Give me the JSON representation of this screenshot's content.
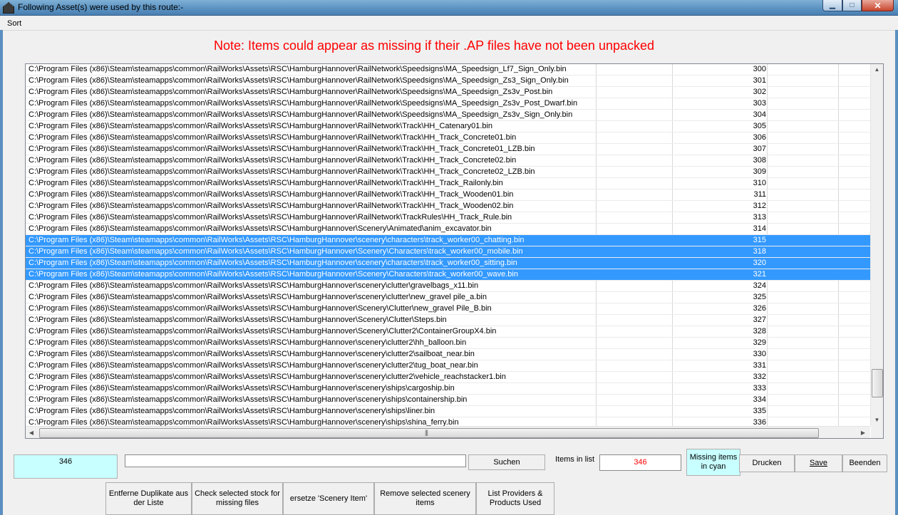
{
  "window": {
    "title": "Following Asset(s) were used by this route:-",
    "minimize_icon": "minimize-icon",
    "maximize_icon": "maximize-icon",
    "close_icon": "close-icon"
  },
  "menu": {
    "sort": "Sort"
  },
  "note": "Note: Items could appear as missing if their .AP files have not been unpacked",
  "list": {
    "rows": [
      {
        "path": "C:\\Program Files (x86)\\Steam\\steamapps\\common\\RailWorks\\Assets\\RSC\\HamburgHannover\\RailNetwork\\Speedsigns\\MA_Speedsign_Lf7_Sign_Only.bin",
        "num": "300",
        "selected": false
      },
      {
        "path": "C:\\Program Files (x86)\\Steam\\steamapps\\common\\RailWorks\\Assets\\RSC\\HamburgHannover\\RailNetwork\\Speedsigns\\MA_Speedsign_Zs3_Sign_Only.bin",
        "num": "301",
        "selected": false
      },
      {
        "path": "C:\\Program Files (x86)\\Steam\\steamapps\\common\\RailWorks\\Assets\\RSC\\HamburgHannover\\RailNetwork\\Speedsigns\\MA_Speedsign_Zs3v_Post.bin",
        "num": "302",
        "selected": false
      },
      {
        "path": "C:\\Program Files (x86)\\Steam\\steamapps\\common\\RailWorks\\Assets\\RSC\\HamburgHannover\\RailNetwork\\Speedsigns\\MA_Speedsign_Zs3v_Post_Dwarf.bin",
        "num": "303",
        "selected": false
      },
      {
        "path": "C:\\Program Files (x86)\\Steam\\steamapps\\common\\RailWorks\\Assets\\RSC\\HamburgHannover\\RailNetwork\\Speedsigns\\MA_Speedsign_Zs3v_Sign_Only.bin",
        "num": "304",
        "selected": false
      },
      {
        "path": "C:\\Program Files (x86)\\Steam\\steamapps\\common\\RailWorks\\Assets\\RSC\\HamburgHannover\\RailNetwork\\Track\\HH_Catenary01.bin",
        "num": "305",
        "selected": false
      },
      {
        "path": "C:\\Program Files (x86)\\Steam\\steamapps\\common\\RailWorks\\Assets\\RSC\\HamburgHannover\\RailNetwork\\Track\\HH_Track_Concrete01.bin",
        "num": "306",
        "selected": false
      },
      {
        "path": "C:\\Program Files (x86)\\Steam\\steamapps\\common\\RailWorks\\Assets\\RSC\\HamburgHannover\\RailNetwork\\Track\\HH_Track_Concrete01_LZB.bin",
        "num": "307",
        "selected": false
      },
      {
        "path": "C:\\Program Files (x86)\\Steam\\steamapps\\common\\RailWorks\\Assets\\RSC\\HamburgHannover\\RailNetwork\\Track\\HH_Track_Concrete02.bin",
        "num": "308",
        "selected": false
      },
      {
        "path": "C:\\Program Files (x86)\\Steam\\steamapps\\common\\RailWorks\\Assets\\RSC\\HamburgHannover\\RailNetwork\\Track\\HH_Track_Concrete02_LZB.bin",
        "num": "309",
        "selected": false
      },
      {
        "path": "C:\\Program Files (x86)\\Steam\\steamapps\\common\\RailWorks\\Assets\\RSC\\HamburgHannover\\RailNetwork\\Track\\HH_Track_Railonly.bin",
        "num": "310",
        "selected": false
      },
      {
        "path": "C:\\Program Files (x86)\\Steam\\steamapps\\common\\RailWorks\\Assets\\RSC\\HamburgHannover\\RailNetwork\\Track\\HH_Track_Wooden01.bin",
        "num": "311",
        "selected": false
      },
      {
        "path": "C:\\Program Files (x86)\\Steam\\steamapps\\common\\RailWorks\\Assets\\RSC\\HamburgHannover\\RailNetwork\\Track\\HH_Track_Wooden02.bin",
        "num": "312",
        "selected": false
      },
      {
        "path": "C:\\Program Files (x86)\\Steam\\steamapps\\common\\RailWorks\\Assets\\RSC\\HamburgHannover\\RailNetwork\\TrackRules\\HH_Track_Rule.bin",
        "num": "313",
        "selected": false
      },
      {
        "path": "C:\\Program Files (x86)\\Steam\\steamapps\\common\\RailWorks\\Assets\\RSC\\HamburgHannover\\Scenery\\Animated\\anim_excavator.bin",
        "num": "314",
        "selected": false
      },
      {
        "path": "C:\\Program Files (x86)\\Steam\\steamapps\\common\\RailWorks\\Assets\\RSC\\HamburgHannover\\scenery\\characters\\track_worker00_chatting.bin",
        "num": "315",
        "selected": true
      },
      {
        "path": "C:\\Program Files (x86)\\Steam\\steamapps\\common\\RailWorks\\Assets\\RSC\\HamburgHannover\\Scenery\\Characters\\track_worker00_mobile.bin",
        "num": "318",
        "selected": true
      },
      {
        "path": "C:\\Program Files (x86)\\Steam\\steamapps\\common\\RailWorks\\Assets\\RSC\\HamburgHannover\\scenery\\characters\\track_worker00_sitting.bin",
        "num": "320",
        "selected": true
      },
      {
        "path": "C:\\Program Files (x86)\\Steam\\steamapps\\common\\RailWorks\\Assets\\RSC\\HamburgHannover\\Scenery\\Characters\\track_worker00_wave.bin",
        "num": "321",
        "selected": true
      },
      {
        "path": "C:\\Program Files (x86)\\Steam\\steamapps\\common\\RailWorks\\Assets\\RSC\\HamburgHannover\\scenery\\clutter\\gravelbags_x11.bin",
        "num": "324",
        "selected": false
      },
      {
        "path": "C:\\Program Files (x86)\\Steam\\steamapps\\common\\RailWorks\\Assets\\RSC\\HamburgHannover\\scenery\\clutter\\new_gravel pile_a.bin",
        "num": "325",
        "selected": false
      },
      {
        "path": "C:\\Program Files (x86)\\Steam\\steamapps\\common\\RailWorks\\Assets\\RSC\\HamburgHannover\\Scenery\\Clutter\\new_gravel Pile_B.bin",
        "num": "326",
        "selected": false
      },
      {
        "path": "C:\\Program Files (x86)\\Steam\\steamapps\\common\\RailWorks\\Assets\\RSC\\HamburgHannover\\Scenery\\Clutter\\Steps.bin",
        "num": "327",
        "selected": false
      },
      {
        "path": "C:\\Program Files (x86)\\Steam\\steamapps\\common\\RailWorks\\Assets\\RSC\\HamburgHannover\\Scenery\\Clutter2\\ContainerGroupX4.bin",
        "num": "328",
        "selected": false
      },
      {
        "path": "C:\\Program Files (x86)\\Steam\\steamapps\\common\\RailWorks\\Assets\\RSC\\HamburgHannover\\scenery\\clutter2\\hh_balloon.bin",
        "num": "329",
        "selected": false
      },
      {
        "path": "C:\\Program Files (x86)\\Steam\\steamapps\\common\\RailWorks\\Assets\\RSC\\HamburgHannover\\scenery\\clutter2\\sailboat_near.bin",
        "num": "330",
        "selected": false
      },
      {
        "path": "C:\\Program Files (x86)\\Steam\\steamapps\\common\\RailWorks\\Assets\\RSC\\HamburgHannover\\scenery\\clutter2\\tug_boat_near.bin",
        "num": "331",
        "selected": false
      },
      {
        "path": "C:\\Program Files (x86)\\Steam\\steamapps\\common\\RailWorks\\Assets\\RSC\\HamburgHannover\\scenery\\clutter2\\vehicle_reachstacker1.bin",
        "num": "332",
        "selected": false
      },
      {
        "path": "C:\\Program Files (x86)\\Steam\\steamapps\\common\\RailWorks\\Assets\\RSC\\HamburgHannover\\scenery\\ships\\cargoship.bin",
        "num": "333",
        "selected": false
      },
      {
        "path": "C:\\Program Files (x86)\\Steam\\steamapps\\common\\RailWorks\\Assets\\RSC\\HamburgHannover\\scenery\\ships\\containership.bin",
        "num": "334",
        "selected": false
      },
      {
        "path": "C:\\Program Files (x86)\\Steam\\steamapps\\common\\RailWorks\\Assets\\RSC\\HamburgHannover\\scenery\\ships\\liner.bin",
        "num": "335",
        "selected": false
      },
      {
        "path": "C:\\Program Files (x86)\\Steam\\steamapps\\common\\RailWorks\\Assets\\RSC\\HamburgHannover\\scenery\\ships\\shina_ferry.bin",
        "num": "336",
        "selected": false
      }
    ],
    "selection_color": "#3399ff"
  },
  "bottom": {
    "count": "346",
    "search_value": "",
    "search_button": "Suchen",
    "items_in_list_label": "Items in list",
    "items_in_list_value": "346",
    "missing_label": "Missing items in cyan",
    "print_button": "Drucken",
    "save_button": "Save",
    "exit_button": "Beenden",
    "actions": [
      "Entferne Duplikate aus der Liste",
      "Check selected stock for missing files",
      "ersetze 'Scenery Item'",
      "Remove selected scenery items",
      "List Providers & Products Used"
    ],
    "cyan_color": "#c8ffff",
    "note_color": "#ff0000"
  }
}
